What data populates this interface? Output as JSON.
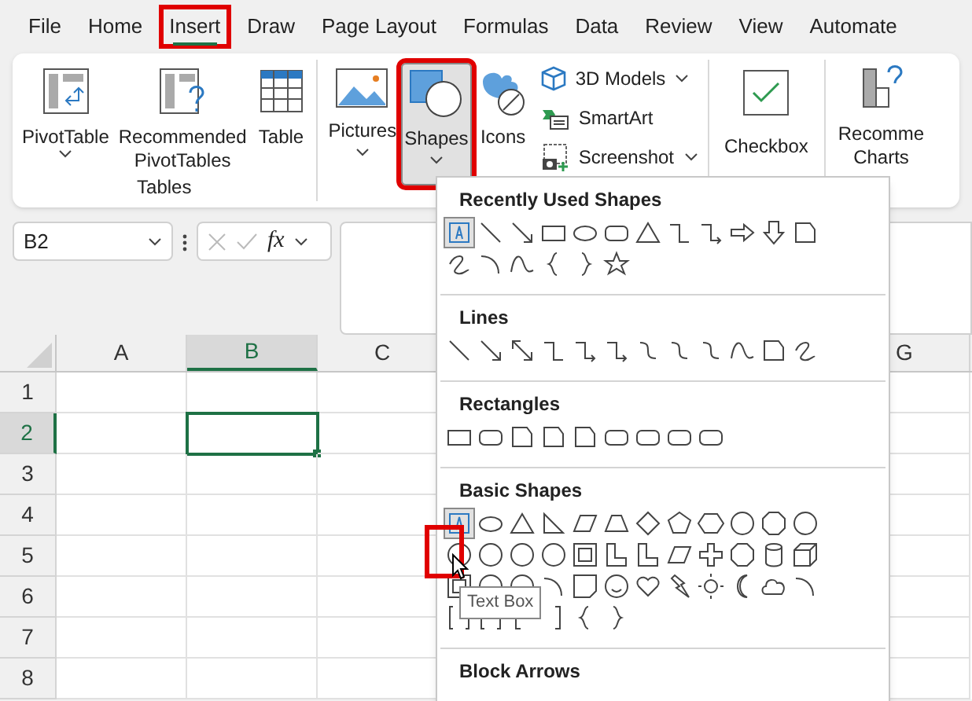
{
  "tabs": [
    {
      "label": "File",
      "selected": false
    },
    {
      "label": "Home",
      "selected": false
    },
    {
      "label": "Insert",
      "selected": true
    },
    {
      "label": "Draw",
      "selected": false
    },
    {
      "label": "Page Layout",
      "selected": false
    },
    {
      "label": "Formulas",
      "selected": false
    },
    {
      "label": "Data",
      "selected": false
    },
    {
      "label": "Review",
      "selected": false
    },
    {
      "label": "View",
      "selected": false
    },
    {
      "label": "Automate",
      "selected": false
    }
  ],
  "ribbon": {
    "tables_group": {
      "label": "Tables",
      "buttons": [
        {
          "kind": "pivot",
          "lines": [
            "PivotTable"
          ],
          "dropdown": true
        },
        {
          "kind": "recpivot",
          "lines": [
            "Recommended",
            "PivotTables"
          ],
          "dropdown": false
        },
        {
          "kind": "table",
          "lines": [
            "Table"
          ],
          "dropdown": false
        }
      ]
    },
    "illustrations": [
      {
        "kind": "pictures",
        "label": "Pictures",
        "dropdown": true,
        "pressed": false
      },
      {
        "kind": "shapes",
        "label": "Shapes",
        "dropdown": true,
        "pressed": true
      },
      {
        "kind": "icons",
        "label": "Icons",
        "dropdown": false,
        "pressed": false
      }
    ],
    "small_buttons": [
      {
        "kind": "models",
        "label": "3D Models",
        "dropdown": true
      },
      {
        "kind": "smartart",
        "label": "SmartArt",
        "dropdown": false
      },
      {
        "kind": "screenshot",
        "label": "Screenshot",
        "dropdown": true
      }
    ],
    "checkbox_button": {
      "label": "Checkbox"
    },
    "charts_button": {
      "lines": [
        "Recomme",
        "Charts"
      ]
    }
  },
  "name_box": {
    "value": "B2"
  },
  "formula_bar": {
    "function_label": "fx"
  },
  "sheet": {
    "columns": [
      {
        "label": "A",
        "selected": false
      },
      {
        "label": "B",
        "selected": true
      },
      {
        "label": "C",
        "selected": false
      },
      {
        "label": "G",
        "selected": false
      }
    ],
    "rows": [
      {
        "label": "1",
        "selected": false
      },
      {
        "label": "2",
        "selected": true
      },
      {
        "label": "3",
        "selected": false
      },
      {
        "label": "4",
        "selected": false
      },
      {
        "label": "5",
        "selected": false
      },
      {
        "label": "6",
        "selected": false
      },
      {
        "label": "7",
        "selected": false
      },
      {
        "label": "8",
        "selected": false
      }
    ]
  },
  "shapes_menu": {
    "sections": [
      {
        "kind": "recent",
        "title": "Recently Used Shapes"
      },
      {
        "kind": "lines",
        "title": "Lines"
      },
      {
        "kind": "rectangles",
        "title": "Rectangles"
      },
      {
        "kind": "basic",
        "title": "Basic Shapes"
      },
      {
        "kind": "block",
        "title": "Block Arrows"
      }
    ]
  },
  "tooltip": {
    "text": "Text Box"
  }
}
